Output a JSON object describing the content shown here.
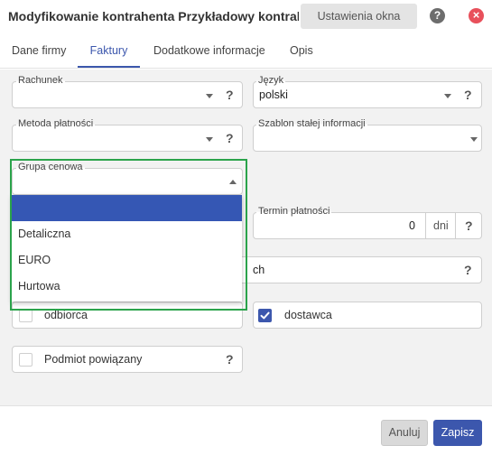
{
  "window": {
    "title": "Modyfikowanie kontrahenta Przykładowy kontrahe...",
    "settings_label": "Ustawienia okna",
    "help_label": "?",
    "close_label": "×"
  },
  "tabs": [
    {
      "label": "Dane firmy"
    },
    {
      "label": "Faktury",
      "active": true
    },
    {
      "label": "Dodatkowe informacje"
    },
    {
      "label": "Opis"
    }
  ],
  "form": {
    "rachunek": {
      "label": "Rachunek",
      "value": "",
      "help": "?"
    },
    "jezyk": {
      "label": "Język",
      "value": "polski",
      "help": "?"
    },
    "metoda": {
      "label": "Metoda płatności",
      "value": "",
      "help": "?"
    },
    "szablon": {
      "label": "Szablon stałej informacji",
      "value": ""
    },
    "grupa": {
      "label": "Grupa cenowa",
      "value": ""
    },
    "termin": {
      "label": "Termin płatności",
      "value": "0",
      "unit": "dni",
      "help": "?"
    },
    "hidden_field": {
      "partial_text": "ch",
      "help": "?"
    },
    "odbiorca": {
      "label": "odbiorca",
      "checked": false
    },
    "dostawca": {
      "label": "dostawca",
      "checked": true
    },
    "podmiot": {
      "label": "Podmiot powiązany",
      "checked": false,
      "help": "?"
    }
  },
  "dropdown": {
    "options": [
      "",
      "Detaliczna",
      "EURO",
      "Hurtowa"
    ],
    "selected_index": 0
  },
  "footer": {
    "cancel_label": "Anuluj",
    "save_label": "Zapisz"
  },
  "colors": {
    "accent": "#3c57ad",
    "selected_option": "#3557b4",
    "highlight_frame": "#2ba34b",
    "close": "#e8505b"
  }
}
